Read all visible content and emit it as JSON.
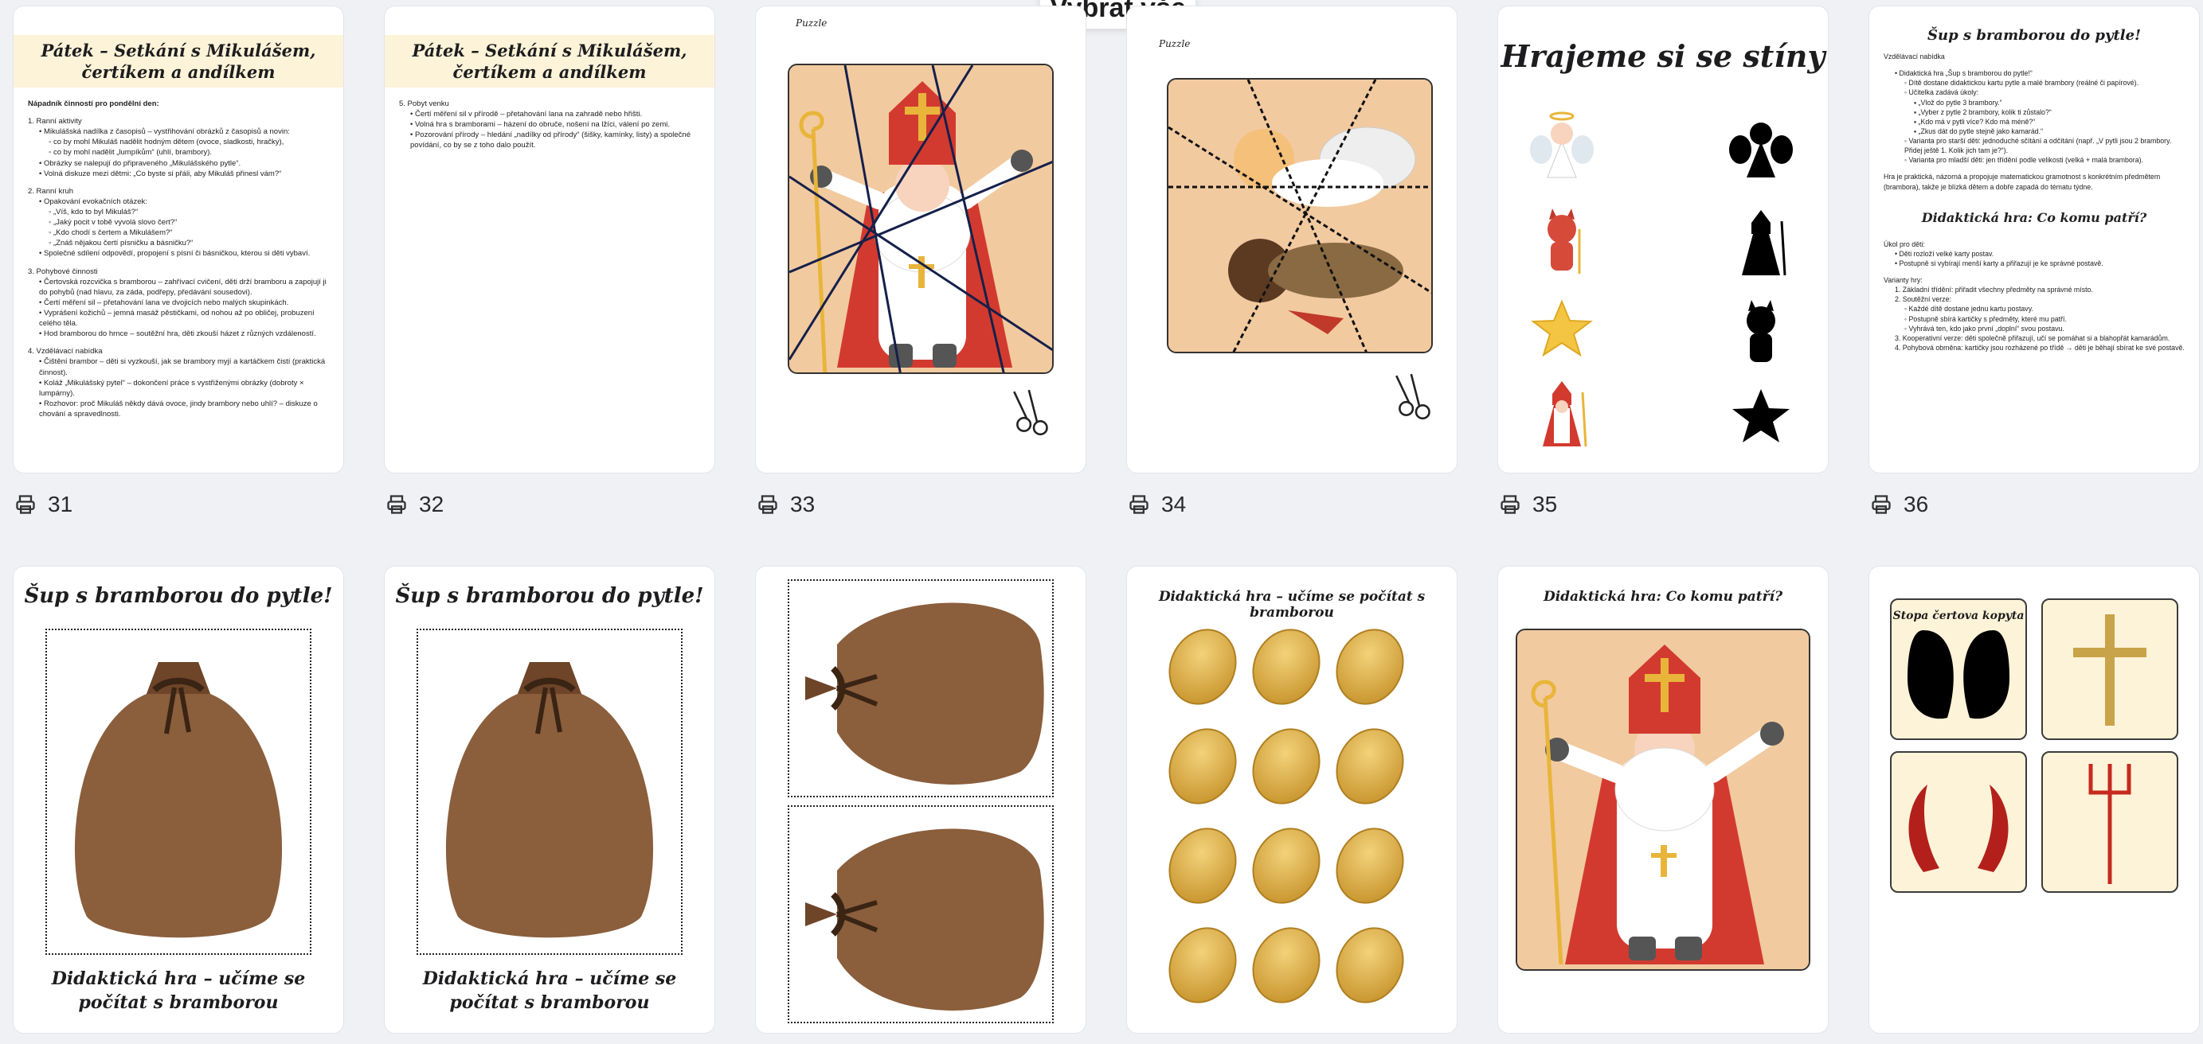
{
  "toolbar": {
    "select_all_label": "Vybrat vše"
  },
  "pages": [
    {
      "number": "31"
    },
    {
      "number": "32"
    },
    {
      "number": "33"
    },
    {
      "number": "34"
    },
    {
      "number": "35"
    },
    {
      "number": "36"
    }
  ],
  "page31": {
    "title_line1": "Pátek – Setkání s Mikulášem,",
    "title_line2": "čertíkem a andílkem",
    "heading": "Nápadník činností pro pondělní den:",
    "s1_title": "1. Ranní aktivity",
    "s1_a": "• Mikulášská nadílka z časopisů – vystřihování obrázků z časopisů a novin:",
    "s1_a1": "◦ co by mohl Mikuláš nadělit hodným dětem (ovoce, sladkosti, hračky),",
    "s1_a2": "◦ co by mohl nadělit „lumpíkům“ (uhlí, brambory).",
    "s1_b": "• Obrázky se nalepují do připraveného „Mikulášského pytle“.",
    "s1_c": "• Volná diskuze mezi dětmi: „Co byste si přáli, aby Mikuláš přinesl vám?“",
    "s2_title": "2. Ranní kruh",
    "s2_a": "• Opakování evokačních otázek:",
    "s2_a1": "◦ „Víš, kdo to byl Mikuláš?“",
    "s2_a2": "◦ „Jaký pocit v tobě vyvolá slovo čert?“",
    "s2_a3": "◦ „Kdo chodí s čertem a Mikulášem?“",
    "s2_a4": "◦ „Znáš nějakou čertí písničku a básničku?“",
    "s2_b": "• Společné sdílení odpovědí, propojení s písní či básničkou, kterou si děti vybaví.",
    "s3_title": "3. Pohybové činnosti",
    "s3_a": "• Čertovská rozcvička s bramborou – zahřívací cvičení, děti drží bramboru a zapojují ji do pohybů (nad hlavu, za záda, podřepy, předávání sousedovi).",
    "s3_b": "• Čertí měření sil – přetahování lana ve dvojicích nebo malých skupinkách.",
    "s3_c": "• Vyprášení kožichů – jemná masáž pěstičkami, od nohou až po obličej, probuzení celého těla.",
    "s3_d": "• Hod bramborou do hrnce – soutěžní hra, děti zkouší házet z různých vzdáleností.",
    "s4_title": "4. Vzdělávací nabídka",
    "s4_a": "• Čištění brambor – děti si vyzkouší, jak se brambory myjí a kartáčkem čistí (praktická činnost).",
    "s4_b": "• Koláž „Mikulášský pytel“ – dokončení práce s vystřiženými obrázky (dobroty × lumpárny).",
    "s4_c": "• Rozhovor: proč Mikuláš někdy dává ovoce, jindy brambory nebo uhlí? – diskuze o chování a spravedlnosti."
  },
  "page32": {
    "title_line1": "Pátek – Setkání s Mikulášem,",
    "title_line2": "čertíkem a andílkem",
    "s5_title": "5. Pobyt venku",
    "s5_a": "• Čertí měření sil v přírodě – přetahování lana na zahradě nebo hřišti.",
    "s5_b": "• Volná hra s bramborami – házení do obruče, nošení na lžíci, válení po zemi.",
    "s5_c": "• Pozorování přírody – hledání „nadílky od přírody“ (šišky, kamínky, listy) a společné povídání, co by se z toho dalo použít."
  },
  "page33": {
    "label": "Puzzle"
  },
  "page34": {
    "label": "Puzzle"
  },
  "page35": {
    "title": "Hrajeme si se stíny"
  },
  "page36": {
    "title": "Šup s bramborou do pytle!",
    "section": "Vzdělávací nabídka",
    "a": "• Didaktická hra „Šup s bramborou do pytle!“",
    "a1": "◦ Dítě dostane didaktickou kartu pytle a malé brambory (reálné či papírové).",
    "a2": "◦ Učitelka zadává úkoly:",
    "a2a": "▪ „Vlož do pytle 3 brambory.“",
    "a2b": "▪ „Vyber z pytle 2 brambory, kolik ti zůstalo?“",
    "a2c": "▪ „Kdo má v pytli více? Kdo má méně?“",
    "a2d": "▪ „Zkus dát do pytle stejně jako kamarád.“",
    "a3": "◦ Varianta pro starší děti: jednoduché sčítání a odčítání (např. „V pytli jsou 2 brambory. Přidej ještě 1. Kolik jich tam je?“).",
    "a4": "◦ Varianta pro mladší děti: jen třídění podle velikosti (velká + malá brambora).",
    "note": "Hra je praktická, názorná a propojuje matematickou gramotnost s konkrétním předmětem (brambora), takže je blízká dětem a dobře zapadá do tématu týdne.",
    "title2": "Didaktická hra: Co komu patří?",
    "goal": "Úkol pro děti:",
    "g1": "• Děti rozloží velké karty postav.",
    "g2": "• Postupně si vybírají menší karty a přiřazují je ke správné postavě.",
    "variants": "Varianty hry:",
    "v1": "1. Základní třídění: přiřadit všechny předměty na správné místo.",
    "v2": "2. Soutěžní verze:",
    "v2a": "◦ Každé dítě dostane jednu kartu postavy.",
    "v2b": "◦ Postupně sbírá kartičky s předměty, které mu patří.",
    "v2c": "◦ Vyhrává ten, kdo jako první „doplní“ svou postavu.",
    "v3": "3. Kooperativní verze: děti společně přiřazují, učí se pomáhat si a blahopřát kamarádům.",
    "v4": "4. Pohybová obměna: kartičky jsou rozházené po třídě → děti je běhají sbírat ke své postavě."
  },
  "page37": {
    "title": "Šup s bramborou do pytle!",
    "caption": "Didaktická hra – učíme se počítat s bramborou"
  },
  "page38": {
    "title": "Šup s bramborou do pytle!",
    "caption": "Didaktická hra – učíme se počítat s bramborou"
  },
  "page40": {
    "title": "Didaktická hra – učíme se počítat s bramborou"
  },
  "page41": {
    "title": "Didaktická hra: Co komu patří?"
  },
  "page42": {
    "label": "Stopa čertova kopyta"
  }
}
